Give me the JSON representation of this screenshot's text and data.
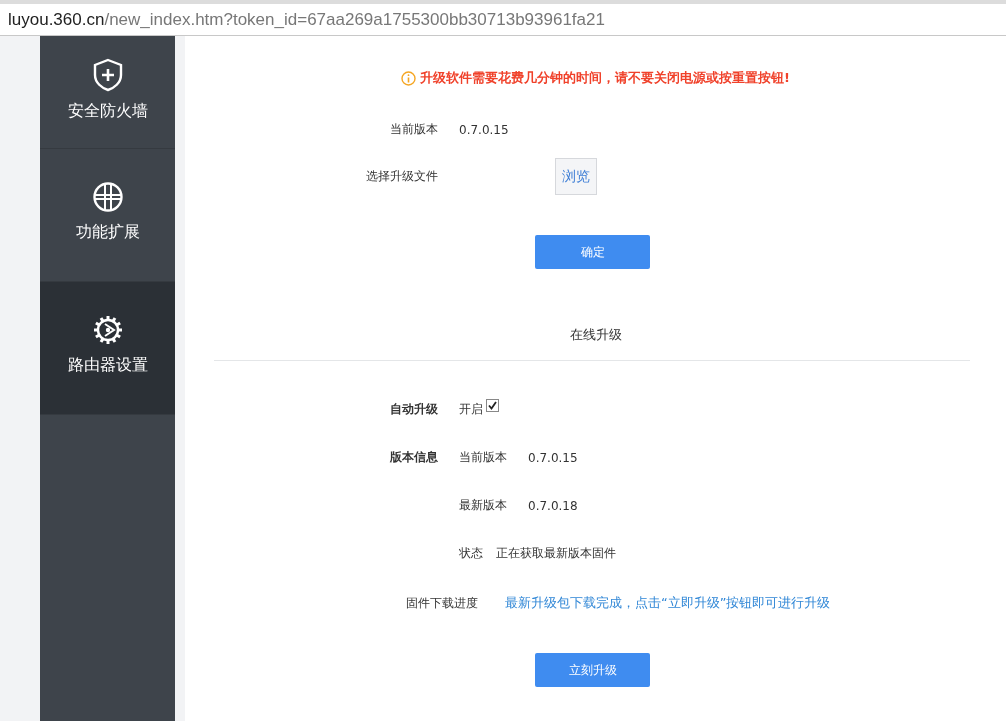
{
  "address_bar": {
    "host": "luyou.360.cn",
    "path": "/new_index.htm?token_id=67aa269a1755300bb30713b93961fa21"
  },
  "sidebar": {
    "items": [
      {
        "kind": "shield",
        "label": "安全防火墙",
        "selected": false
      },
      {
        "kind": "grid",
        "label": "功能扩展",
        "selected": false
      },
      {
        "kind": "gear",
        "label": "路由器设置",
        "selected": true
      }
    ]
  },
  "manual_upgrade": {
    "warning": "升级软件需要花费几分钟的时间，请不要关闭电源或按重置按钮!",
    "current_label": "当前版本",
    "current_value": "0.7.0.15",
    "file_label": "选择升级文件",
    "browse_button": "浏览",
    "confirm_button": "确定"
  },
  "online_upgrade": {
    "title": "在线升级",
    "auto_upgrade": {
      "label": "自动升级",
      "option": "开启",
      "checked": true
    },
    "version_info": {
      "label": "版本信息",
      "current_label": "当前版本",
      "current_value": "0.7.0.15",
      "latest_label": "最新版本",
      "latest_value": "0.7.0.18",
      "status_label": "状态",
      "status_value": "正在获取最新版本固件"
    },
    "download": {
      "label": "固件下载进度",
      "message": "最新升级包下载完成，点击“立即升级”按钮即可进行升级"
    },
    "upgrade_button": "立刻升级"
  }
}
